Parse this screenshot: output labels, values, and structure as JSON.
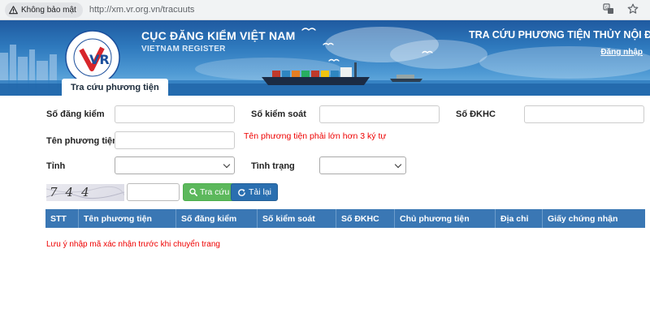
{
  "browser": {
    "security_label": "Không bảo mật",
    "url": "http://xm.vr.org.vn/tracuuts"
  },
  "header": {
    "brand_title": "CỤC ĐĂNG KIỂM VIỆT NAM",
    "brand_subtitle": "VIETNAM REGISTER",
    "page_title": "TRA CỨU PHƯƠNG TIỆN THỦY NỘI ĐỊA",
    "login_label": "Đăng nhập",
    "logo_text": "VR",
    "tab_label": "Tra cứu phương tiện",
    "colors": {
      "banner_top": "#1f5aa0",
      "banner_bottom": "#7dbce6",
      "logo_red": "#d7262b",
      "logo_blue": "#1c4f9c"
    }
  },
  "form": {
    "registration_no_label": "Số đăng kiểm",
    "control_no_label": "Số kiểm soát",
    "admin_reg_label": "Số ĐKHC",
    "vessel_name_label": "Tên phương tiện",
    "vessel_name_error": "Tên phương tiện phải lớn hơn 3 ký tự",
    "province_label": "Tỉnh",
    "status_label": "Tình trạng",
    "captcha_text": "744 2",
    "search_button": "Tra cứu",
    "reload_button": "Tải lại"
  },
  "table": {
    "columns": [
      "STT",
      "Tên phương tiện",
      "Số đăng kiểm",
      "Số kiểm soát",
      "Số ĐKHC",
      "Chủ phương tiện",
      "Địa chỉ",
      "Giấy chứng nhận"
    ]
  },
  "notice": "Lưu ý nhập mã xác nhận trước khi chuyển trang",
  "icons": {
    "warning": "warning-triangle-icon",
    "translate": "translate-icon",
    "bookmark": "star-icon",
    "search": "search-icon",
    "reload": "refresh-icon"
  },
  "colors": {
    "accent": "#3a77b4",
    "success": "#5cb85c",
    "primary": "#2a6fb0",
    "error": "#e00000"
  }
}
